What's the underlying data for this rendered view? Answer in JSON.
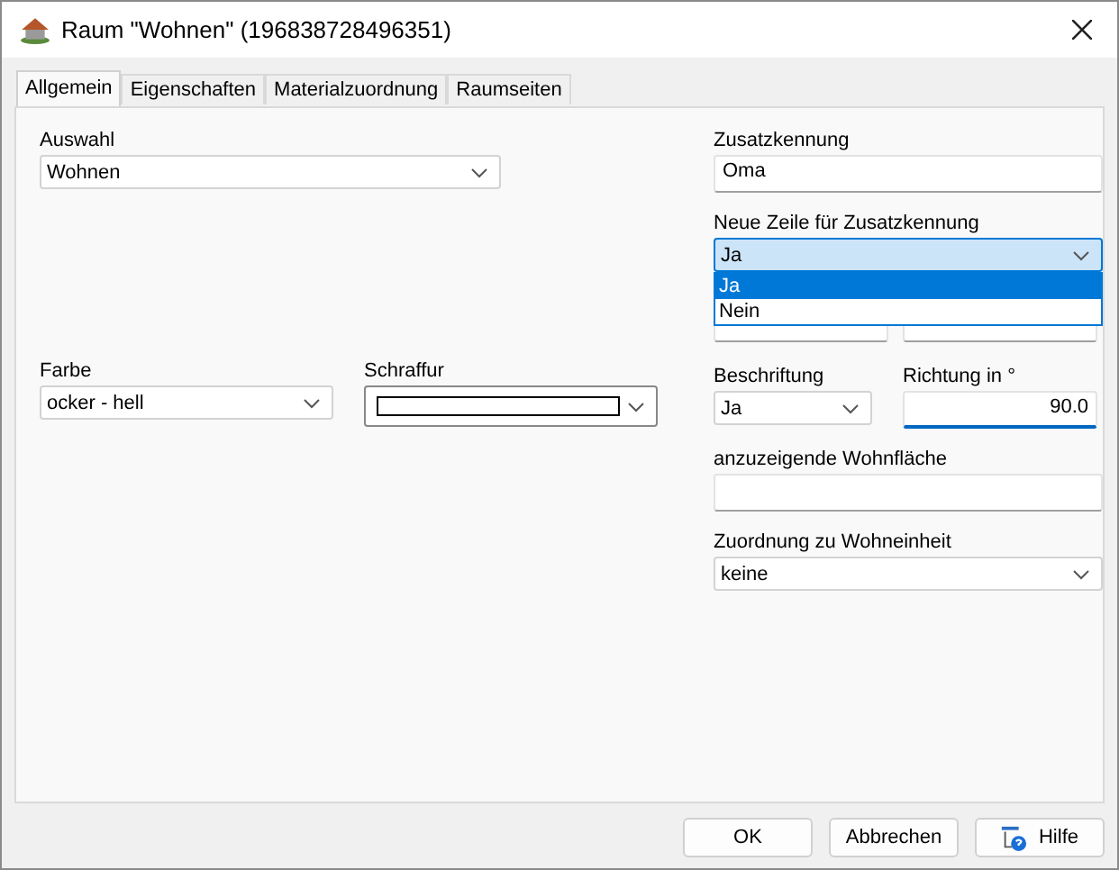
{
  "window": {
    "title": "Raum \"Wohnen\" (196838728496351)"
  },
  "tabs": [
    {
      "label": "Allgemein",
      "selected": true
    },
    {
      "label": "Eigenschaften",
      "selected": false
    },
    {
      "label": "Materialzuordnung",
      "selected": false
    },
    {
      "label": "Raumseiten",
      "selected": false
    }
  ],
  "auswahl": {
    "label": "Auswahl",
    "value": "Wohnen"
  },
  "zusatzkennung": {
    "label": "Zusatzkennung",
    "value": "Oma"
  },
  "neue_zeile": {
    "label": "Neue Zeile für Zusatzkennung",
    "value": "Ja",
    "focused": true,
    "options": [
      {
        "label": "Ja",
        "selected": true
      },
      {
        "label": "Nein",
        "selected": false
      }
    ]
  },
  "covered_fields": [
    {
      "kind": "input"
    },
    {
      "kind": "input"
    }
  ],
  "farbe": {
    "label": "Farbe",
    "value": "ocker - hell"
  },
  "schraffur": {
    "label": "Schraffur"
  },
  "beschriftung": {
    "label": "Beschriftung",
    "value": "Ja"
  },
  "richtung": {
    "label": "Richtung in °",
    "value": "90.0",
    "focused": true
  },
  "wohnflaeche": {
    "label": "anzuzeigende Wohnfläche"
  },
  "zuordnung": {
    "label": "Zuordnung zu Wohneinheit",
    "value": "keine"
  },
  "buttons": [
    {
      "label": "OK",
      "kind": "plain"
    },
    {
      "label": "Abbrechen",
      "kind": "plain"
    },
    {
      "label": "Hilfe",
      "kind": "help"
    }
  ]
}
